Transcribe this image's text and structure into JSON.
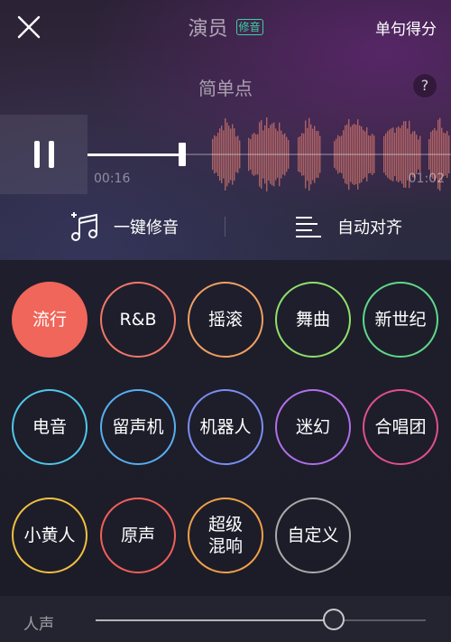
{
  "header": {
    "close_icon": "close-icon",
    "title": "演员",
    "title_tag": "修音",
    "score_button": "单句得分"
  },
  "subtitle": "简单点",
  "help_label": "?",
  "player": {
    "current_time": "00:16",
    "total_time": "01:02",
    "progress": 0.26,
    "pause_icon": "pause-icon"
  },
  "actions": {
    "auto_tune": {
      "label": "一键修音",
      "icon": "music-notes-icon"
    },
    "auto_align": {
      "label": "自动对齐",
      "icon": "align-lines-icon"
    }
  },
  "effects": [
    {
      "label": "流行",
      "color": "#f0665a",
      "active": true
    },
    {
      "label": "R&B",
      "color": "#f07868",
      "active": false
    },
    {
      "label": "摇滚",
      "color": "#f0a060",
      "active": false
    },
    {
      "label": "舞曲",
      "color": "#8ee06a",
      "active": false
    },
    {
      "label": "新世纪",
      "color": "#5ed88a",
      "active": false
    },
    {
      "label": "电音",
      "color": "#4ec8e8",
      "active": false
    },
    {
      "label": "留声机",
      "color": "#58aef0",
      "active": false
    },
    {
      "label": "机器人",
      "color": "#7a8ef0",
      "active": false
    },
    {
      "label": "迷幻",
      "color": "#b070e8",
      "active": false
    },
    {
      "label": "合唱团",
      "color": "#e0508a",
      "active": false
    },
    {
      "label": "小黄人",
      "color": "#f0c040",
      "active": false
    },
    {
      "label": "原声",
      "color": "#f06058",
      "active": false
    },
    {
      "label": "超级混响",
      "color": "#f0a048",
      "active": false
    },
    {
      "label": "自定义",
      "color": "#aaaaaa",
      "active": false
    }
  ],
  "vocal": {
    "label": "人声",
    "value": 0.72
  },
  "colors": {
    "accent": "#f0665a",
    "tag_green": "#3ad0a0",
    "waveform": "#c9706a"
  }
}
